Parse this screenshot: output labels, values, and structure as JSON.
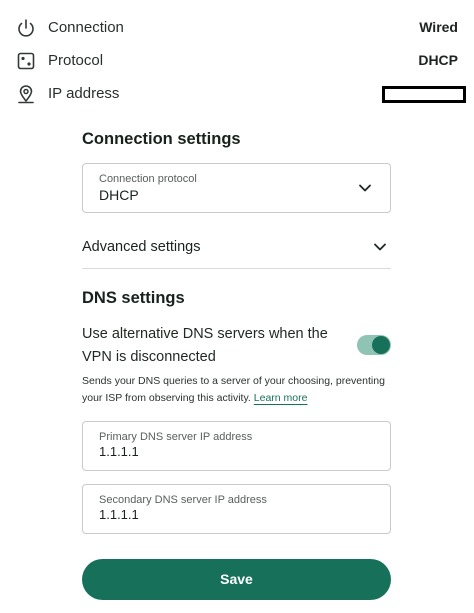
{
  "info": [
    {
      "icon": "power-icon",
      "label": "Connection",
      "value": "Wired"
    },
    {
      "icon": "protocol-icon",
      "label": "Protocol",
      "value": "DHCP"
    },
    {
      "icon": "location-pin-icon",
      "label": "IP address",
      "value": ""
    }
  ],
  "connection_settings": {
    "heading": "Connection settings",
    "protocol_label": "Connection protocol",
    "protocol_value": "DHCP"
  },
  "advanced": {
    "label": "Advanced settings"
  },
  "dns": {
    "heading": "DNS settings",
    "toggle_label": "Use alternative DNS servers when the VPN is disconnected",
    "toggle_on": true,
    "description": "Sends your DNS queries to a server of your choosing, preventing your ISP from observing this activity.",
    "learn_more": "Learn more",
    "primary_label": "Primary DNS server IP address",
    "primary_value": "1.1.1.1",
    "secondary_label": "Secondary DNS server IP address",
    "secondary_value": "1.1.1.1"
  },
  "save_label": "Save",
  "colors": {
    "accent": "#17715a",
    "toggle_track": "#8fc4b5"
  }
}
